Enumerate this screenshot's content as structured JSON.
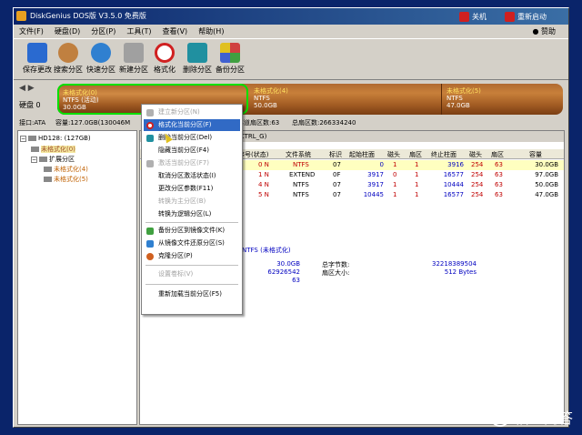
{
  "titlebar": {
    "title": "DiskGenius DOS版 V3.5.0 免费版",
    "shutdown": "关机",
    "restart": "重新启动"
  },
  "menu": {
    "items": [
      "文件(F)",
      "硬盘(D)",
      "分区(P)",
      "工具(T)",
      "查看(V)",
      "帮助(H)"
    ],
    "donate": "赞助"
  },
  "toolbar": {
    "buttons": [
      {
        "label": "保存更改",
        "icon": "save-icon",
        "color": "#2a6ad0"
      },
      {
        "label": "搜索分区",
        "icon": "magnifier-icon",
        "color": "#c08040"
      },
      {
        "label": "快速分区",
        "icon": "globe-icon",
        "color": "#3080d0"
      },
      {
        "label": "新建分区",
        "icon": "new-partition-icon",
        "color": "#808080"
      },
      {
        "label": "格式化",
        "icon": "format-icon",
        "color": "#d02020"
      },
      {
        "label": "删除分区",
        "icon": "trash-icon",
        "color": "#2090a0"
      },
      {
        "label": "备份分区",
        "icon": "backup-icon",
        "color": "#40a040"
      }
    ]
  },
  "diskbar": {
    "disk_label": "硬盘 0",
    "partitions": [
      {
        "name": "未格式化(0)",
        "fs": "NTFS (活动)",
        "size": "30.0GB"
      },
      {
        "name": "未格式化(4)",
        "fs": "NTFS",
        "size": "50.0GB"
      },
      {
        "name": "未格式化(5)",
        "fs": "NTFS",
        "size": "47.0GB"
      }
    ]
  },
  "infobar": {
    "iface": "接口:ATA",
    "capacity": "容量:127.0GB(130046M",
    "sectors_per_track": "每道扇区数:63",
    "total_sectors": "总扇区数:266334240"
  },
  "tree": {
    "disk": "HD128: (127GB)",
    "p0": "未格式化(0)",
    "ext": "扩展分区",
    "p4": "未格式化(4)",
    "p5": "未格式化(5)"
  },
  "tab": {
    "label": "件(CTRL_G)"
  },
  "table": {
    "headers": [
      "序号(状态)",
      "文件系统",
      "标识",
      "起始柱面",
      "磁头",
      "扇区",
      "终止柱面",
      "磁头",
      "扇区",
      "容量"
    ],
    "rows": [
      [
        "0 N",
        "NTFS",
        "07",
        "0",
        "1",
        "1",
        "3916",
        "254",
        "63",
        "30.0GB"
      ],
      [
        "1 N",
        "EXTEND",
        "0F",
        "3917",
        "0",
        "1",
        "16577",
        "254",
        "63",
        "97.0GB"
      ],
      [
        "4 N",
        "NTFS",
        "07",
        "3917",
        "1",
        "1",
        "10444",
        "254",
        "63",
        "50.0GB"
      ],
      [
        "5 N",
        "NTFS",
        "07",
        "10445",
        "1",
        "1",
        "16577",
        "254",
        "63",
        "47.0GB"
      ]
    ]
  },
  "detail": {
    "header": "NTFS (未格式化)",
    "v1": "30.0GB",
    "v2": "62926542",
    "v3": "63",
    "label_total": "总字节数:",
    "label_sector": "扇区大小:",
    "total_bytes": "32218389504",
    "sector_size": "512 Bytes"
  },
  "context_menu": {
    "items": [
      {
        "label": "建立新分区(N)",
        "disabled": true
      },
      {
        "label": "格式化当前分区(F)",
        "highlight": true
      },
      {
        "label": "删除当前分区(Del)"
      },
      {
        "label": "隐藏当前分区(F4)"
      },
      {
        "label": "激活当前分区(F7)",
        "disabled": true
      },
      {
        "label": "取消分区激活状态(I)"
      },
      {
        "label": "更改分区参数(F11)"
      },
      {
        "label": "转换为主分区(B)",
        "disabled": true
      },
      {
        "label": "转换为逻辑分区(L)"
      },
      {
        "label": "备份分区到镜像文件(K)"
      },
      {
        "label": "从镜像文件还原分区(S)"
      },
      {
        "label": "克隆分区(P)"
      },
      {
        "label": "设置卷标(V)",
        "disabled": true
      },
      {
        "label": "重新加载当前分区(F5)"
      }
    ]
  },
  "watermark": {
    "text": "悟空问答"
  }
}
